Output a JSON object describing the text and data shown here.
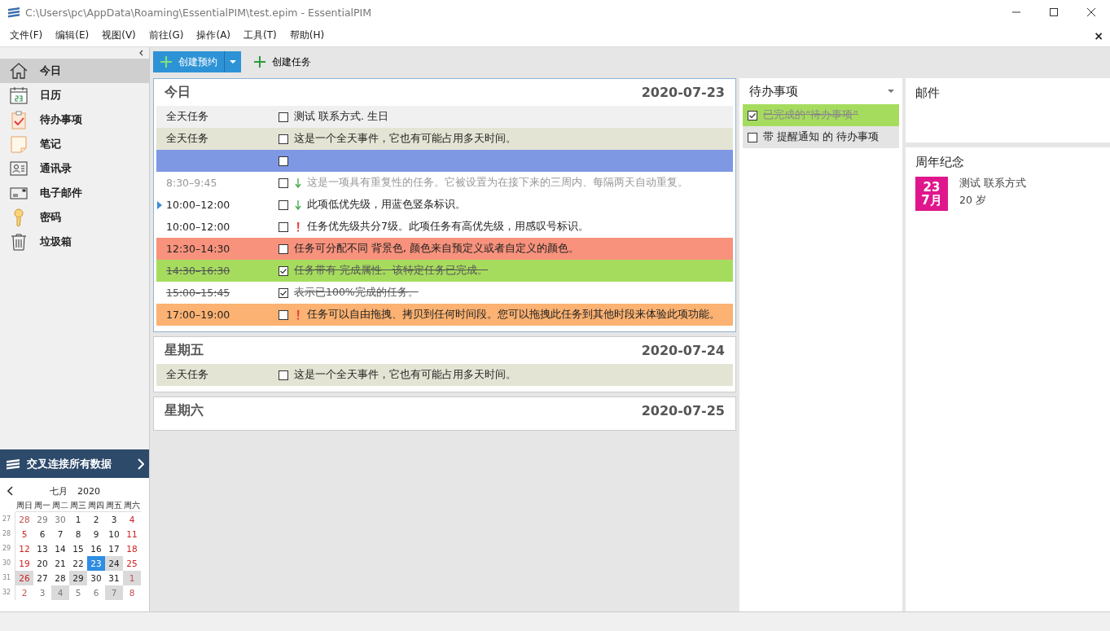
{
  "window": {
    "title": "C:\\Users\\pc\\AppData\\Roaming\\EssentialPIM\\test.epim - EssentialPIM"
  },
  "menu": [
    "文件(F)",
    "编辑(E)",
    "视图(V)",
    "前往(G)",
    "操作(A)",
    "工具(T)",
    "帮助(H)"
  ],
  "menu_close": "×",
  "sidebar": {
    "items": [
      {
        "label": "今日",
        "kind": "home",
        "selected": true
      },
      {
        "label": "日历",
        "kind": "calendar",
        "selected": false
      },
      {
        "label": "待办事项",
        "kind": "todo",
        "selected": false
      },
      {
        "label": "笔记",
        "kind": "note",
        "selected": false
      },
      {
        "label": "通讯录",
        "kind": "contacts",
        "selected": false
      },
      {
        "label": "电子邮件",
        "kind": "mail",
        "selected": false
      },
      {
        "label": "密码",
        "kind": "key",
        "selected": false
      },
      {
        "label": "垃圾箱",
        "kind": "trash",
        "selected": false
      }
    ],
    "crosslink": "交叉连接所有数据"
  },
  "mini_calendar": {
    "month": "七月",
    "year": "2020",
    "weekdays": [
      "周日",
      "周一",
      "周二",
      "周三",
      "周四",
      "周五",
      "周六"
    ],
    "weeks": [
      {
        "num": "27",
        "days": [
          {
            "d": "28",
            "other": true,
            "weekend": true,
            "marked": false,
            "selected": false
          },
          {
            "d": "29",
            "other": true,
            "weekend": false,
            "marked": false,
            "selected": false
          },
          {
            "d": "30",
            "other": true,
            "weekend": false,
            "marked": false,
            "selected": false
          },
          {
            "d": "1",
            "other": false,
            "weekend": false,
            "marked": false,
            "selected": false
          },
          {
            "d": "2",
            "other": false,
            "weekend": false,
            "marked": false,
            "selected": false
          },
          {
            "d": "3",
            "other": false,
            "weekend": false,
            "marked": false,
            "selected": false
          },
          {
            "d": "4",
            "other": false,
            "weekend": true,
            "marked": false,
            "selected": false
          }
        ]
      },
      {
        "num": "28",
        "days": [
          {
            "d": "5",
            "other": false,
            "weekend": true,
            "marked": false,
            "selected": false
          },
          {
            "d": "6",
            "other": false,
            "weekend": false,
            "marked": false,
            "selected": false
          },
          {
            "d": "7",
            "other": false,
            "weekend": false,
            "marked": false,
            "selected": false
          },
          {
            "d": "8",
            "other": false,
            "weekend": false,
            "marked": false,
            "selected": false
          },
          {
            "d": "9",
            "other": false,
            "weekend": false,
            "marked": false,
            "selected": false
          },
          {
            "d": "10",
            "other": false,
            "weekend": false,
            "marked": false,
            "selected": false
          },
          {
            "d": "11",
            "other": false,
            "weekend": true,
            "marked": false,
            "selected": false
          }
        ]
      },
      {
        "num": "29",
        "days": [
          {
            "d": "12",
            "other": false,
            "weekend": true,
            "marked": false,
            "selected": false
          },
          {
            "d": "13",
            "other": false,
            "weekend": false,
            "marked": false,
            "selected": false
          },
          {
            "d": "14",
            "other": false,
            "weekend": false,
            "marked": false,
            "selected": false
          },
          {
            "d": "15",
            "other": false,
            "weekend": false,
            "marked": false,
            "selected": false
          },
          {
            "d": "16",
            "other": false,
            "weekend": false,
            "marked": false,
            "selected": false
          },
          {
            "d": "17",
            "other": false,
            "weekend": false,
            "marked": false,
            "selected": false
          },
          {
            "d": "18",
            "other": false,
            "weekend": true,
            "marked": false,
            "selected": false
          }
        ]
      },
      {
        "num": "30",
        "days": [
          {
            "d": "19",
            "other": false,
            "weekend": true,
            "marked": false,
            "selected": false
          },
          {
            "d": "20",
            "other": false,
            "weekend": false,
            "marked": false,
            "selected": false
          },
          {
            "d": "21",
            "other": false,
            "weekend": false,
            "marked": false,
            "selected": false
          },
          {
            "d": "22",
            "other": false,
            "weekend": false,
            "marked": false,
            "selected": false
          },
          {
            "d": "23",
            "other": false,
            "weekend": false,
            "marked": false,
            "selected": true
          },
          {
            "d": "24",
            "other": false,
            "weekend": false,
            "marked": true,
            "selected": false
          },
          {
            "d": "25",
            "other": false,
            "weekend": true,
            "marked": false,
            "selected": false
          }
        ]
      },
      {
        "num": "31",
        "days": [
          {
            "d": "26",
            "other": false,
            "weekend": true,
            "marked": true,
            "selected": false
          },
          {
            "d": "27",
            "other": false,
            "weekend": false,
            "marked": false,
            "selected": false
          },
          {
            "d": "28",
            "other": false,
            "weekend": false,
            "marked": false,
            "selected": false
          },
          {
            "d": "29",
            "other": false,
            "weekend": false,
            "marked": true,
            "selected": false
          },
          {
            "d": "30",
            "other": false,
            "weekend": false,
            "marked": false,
            "selected": false
          },
          {
            "d": "31",
            "other": false,
            "weekend": false,
            "marked": false,
            "selected": false
          },
          {
            "d": "1",
            "other": true,
            "weekend": true,
            "marked": true,
            "selected": false
          }
        ]
      },
      {
        "num": "32",
        "days": [
          {
            "d": "2",
            "other": true,
            "weekend": true,
            "marked": false,
            "selected": false
          },
          {
            "d": "3",
            "other": true,
            "weekend": false,
            "marked": false,
            "selected": false
          },
          {
            "d": "4",
            "other": true,
            "weekend": false,
            "marked": true,
            "selected": false
          },
          {
            "d": "5",
            "other": true,
            "weekend": false,
            "marked": false,
            "selected": false
          },
          {
            "d": "6",
            "other": true,
            "weekend": false,
            "marked": false,
            "selected": false
          },
          {
            "d": "7",
            "other": true,
            "weekend": false,
            "marked": true,
            "selected": false
          },
          {
            "d": "8",
            "other": true,
            "weekend": true,
            "marked": false,
            "selected": false
          }
        ]
      }
    ]
  },
  "toolbar": {
    "new_appointment": "创建预约",
    "new_task": "创建任务"
  },
  "days": [
    {
      "title": "今日",
      "date": "2020-07-23",
      "selected": true,
      "rows": [
        {
          "time": "全天任务",
          "text": "测试 联系方式. 生日",
          "color": "#f0f0f0",
          "checked": false,
          "done": false,
          "faded": false
        },
        {
          "time": "全天任务",
          "text": "这是一个全天事件，它也有可能占用多天时间。",
          "color": "#e4e4d4",
          "checked": false,
          "done": false,
          "faded": false
        },
        {
          "color": "#7f98e4",
          "checked": false
        },
        {
          "time": "8:30–9:45",
          "text": "这是一项具有重复性的任务。它被设置为在接下来的三周内、每隔两天自动重复。",
          "color": "#ffffff",
          "checked": false,
          "done": false,
          "faded": true,
          "low_priority": true
        },
        {
          "time": "10:00–12:00",
          "text": "此项低优先级，用蓝色竖条标识。",
          "color": "#ffffff",
          "checked": false,
          "done": false,
          "faded": false,
          "low_priority": true,
          "current": true
        },
        {
          "time": "10:00–12:00",
          "text": "任务优先级共分7级。此项任务有高优先级，用感叹号标识。",
          "color": "#ffffff",
          "checked": false,
          "done": false,
          "faded": false,
          "high_priority": true
        },
        {
          "time": "12:30–14:30",
          "text": "任务可分配不同 背景色, 颜色来自预定义或者自定义的颜色。",
          "color": "#f8927c",
          "checked": false,
          "done": false,
          "faded": false
        },
        {
          "time": "14:30–16:30",
          "text": "任务带有 完成属性。该特定任务已完成。",
          "color": "#a6dc5e",
          "checked": true,
          "done": true,
          "faded": false
        },
        {
          "time": "15:00–15:45",
          "text": "表示已100%完成的任务。",
          "color": "#ffffff",
          "checked": true,
          "done": true,
          "faded": false
        },
        {
          "time": "17:00–19:00",
          "text": "任务可以自由拖拽、拷贝到任何时间段。您可以拖拽此任务到其他时段来体验此项功能。",
          "color": "#fbb272",
          "checked": false,
          "done": false,
          "faded": false,
          "high_priority": true
        }
      ]
    },
    {
      "title": "星期五",
      "date": "2020-07-24",
      "selected": false,
      "rows": [
        {
          "time": "全天任务",
          "text": "这是一个全天事件，它也有可能占用多天时间。",
          "color": "#e4e4d4",
          "checked": false,
          "done": false,
          "faded": false
        }
      ]
    },
    {
      "title": "星期六",
      "date": "2020-07-25",
      "selected": false
    }
  ],
  "todo_panel": {
    "title": "待办事项",
    "items": [
      {
        "text": "已完成的“待办事项”",
        "checked": true,
        "done": true,
        "color": "#a6dc5e"
      },
      {
        "text": "带 提醒通知 的 待办事项",
        "checked": false,
        "done": false,
        "color": "#e4e4e4"
      }
    ]
  },
  "mail_panel": {
    "title": "邮件"
  },
  "anniversary_panel": {
    "title": "周年纪念",
    "items": [
      {
        "day": "23",
        "month": "7月",
        "name": "测试 联系方式",
        "age": "20 岁"
      }
    ]
  }
}
